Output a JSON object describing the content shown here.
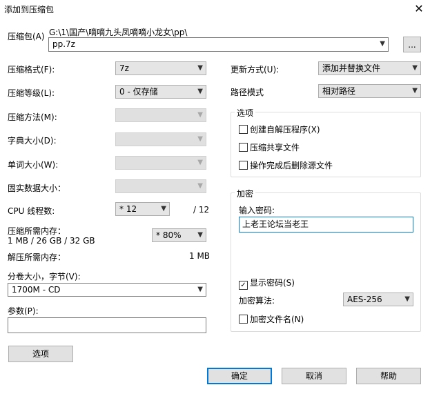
{
  "window": {
    "title": "添加到压缩包",
    "close_glyph": "✕"
  },
  "archive": {
    "label": "压缩包(A)",
    "path": "G:\\1\\国产\\嘀嘀九头凤嘀嘀小龙女\\pp\\",
    "filename": "pp.7z",
    "browse_label": "..."
  },
  "left": {
    "format": {
      "label": "压缩格式(F):",
      "value": "7z"
    },
    "level": {
      "label": "压缩等级(L):",
      "value": "0 - 仅存储"
    },
    "method": {
      "label": "压缩方法(M):",
      "value": ""
    },
    "dict": {
      "label": "字典大小(D):",
      "value": ""
    },
    "word": {
      "label": "单词大小(W):",
      "value": ""
    },
    "solid": {
      "label": "固实数据大小：",
      "value": ""
    },
    "threads": {
      "label": "CPU 线程数:",
      "value": "* 12",
      "max": "/ 12"
    },
    "mem_compress": {
      "label": "压缩所需内存：",
      "detail": "1 MB / 26 GB / 32 GB",
      "value": "* 80%"
    },
    "mem_decompress": {
      "label": "解压所需内存：",
      "value": "1 MB"
    },
    "volume": {
      "label": "分卷大小，字节(V):",
      "value": "1700M - CD"
    },
    "params": {
      "label": "参数(P):",
      "value": ""
    },
    "options_button": "选项"
  },
  "right": {
    "update": {
      "label": "更新方式(U):",
      "value": "添加并替换文件"
    },
    "pathmode": {
      "label": "路径模式",
      "value": "相对路径"
    },
    "options_group": {
      "title": "选项",
      "items": [
        {
          "label": "创建自解压程序(X)",
          "checked": false
        },
        {
          "label": "压缩共享文件",
          "checked": false
        },
        {
          "label": "操作完成后删除源文件",
          "checked": false
        }
      ]
    },
    "encryption": {
      "title": "加密",
      "password_label": "输入密码:",
      "password_value": "上老王论坛当老王",
      "show_password": {
        "label": "显示密码(S)",
        "checked": true
      },
      "method_label": "加密算法:",
      "method_value": "AES-256",
      "encrypt_names": {
        "label": "加密文件名(N)",
        "checked": false
      }
    }
  },
  "footer": {
    "ok": "确定",
    "cancel": "取消",
    "help": "帮助"
  },
  "icons": {
    "dropdown": "chevron-down-icon",
    "close": "close-icon",
    "check": "check-icon"
  }
}
